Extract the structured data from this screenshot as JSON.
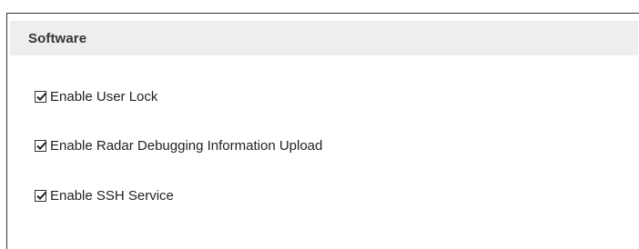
{
  "section": {
    "title": "Software",
    "options": [
      {
        "label": "Enable User Lock",
        "checked": true
      },
      {
        "label": "Enable Radar Debugging Information Upload",
        "checked": true
      },
      {
        "label": "Enable SSH Service",
        "checked": true
      }
    ]
  },
  "icons": {
    "checkbox_checked": "checkbox-checked-icon"
  },
  "colors": {
    "header_bg": "#eeeeee",
    "text": "#222222",
    "border": "#333333"
  }
}
